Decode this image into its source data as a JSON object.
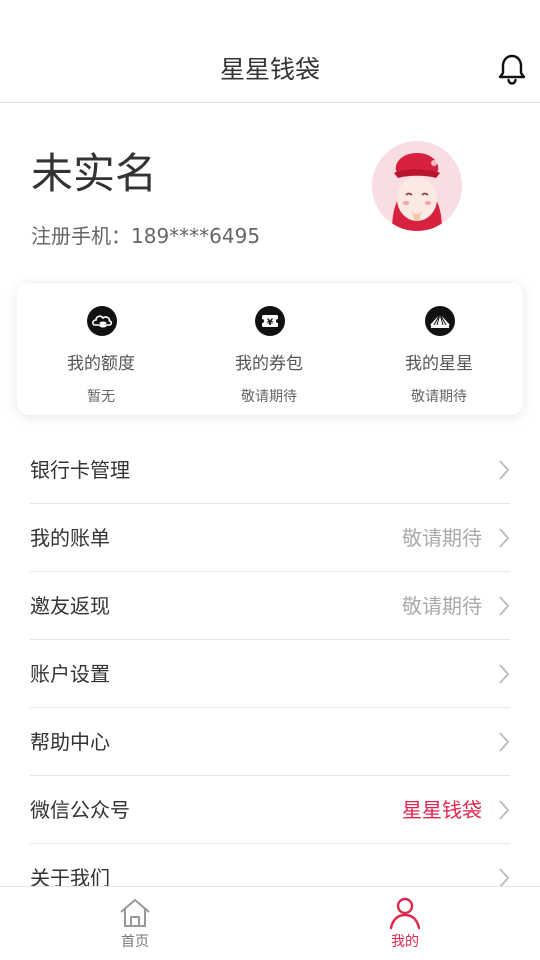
{
  "header": {
    "title": "星星钱袋",
    "bell_icon": "bell-icon"
  },
  "profile": {
    "name": "未实名",
    "phone": "注册手机：189****6495",
    "avatar_icon": "money-bag-avatar"
  },
  "card": {
    "items": [
      {
        "label": "我的额度",
        "sub": "暂无",
        "icon": "credit-cloud-icon"
      },
      {
        "label": "我的券包",
        "sub": "敬请期待",
        "icon": "coupon-icon"
      },
      {
        "label": "我的星星",
        "sub": "敬请期待",
        "icon": "star-fan-icon"
      }
    ]
  },
  "menu": [
    {
      "label": "银行卡管理",
      "value": ""
    },
    {
      "label": "我的账单",
      "value": "敬请期待"
    },
    {
      "label": "邀友返现",
      "value": "敬请期待"
    },
    {
      "label": "账户设置",
      "value": ""
    },
    {
      "label": "帮助中心",
      "value": ""
    },
    {
      "label": "微信公众号",
      "value": "星星钱袋"
    },
    {
      "label": "关于我们",
      "value": ""
    }
  ],
  "tabbar": {
    "tabs": [
      {
        "label": "首页",
        "icon": "home-icon"
      },
      {
        "label": "我的",
        "icon": "profile-icon",
        "active": true
      }
    ]
  },
  "colors": {
    "accent": "#e0264d",
    "text": "#333333",
    "muted": "#aaaaaa"
  }
}
